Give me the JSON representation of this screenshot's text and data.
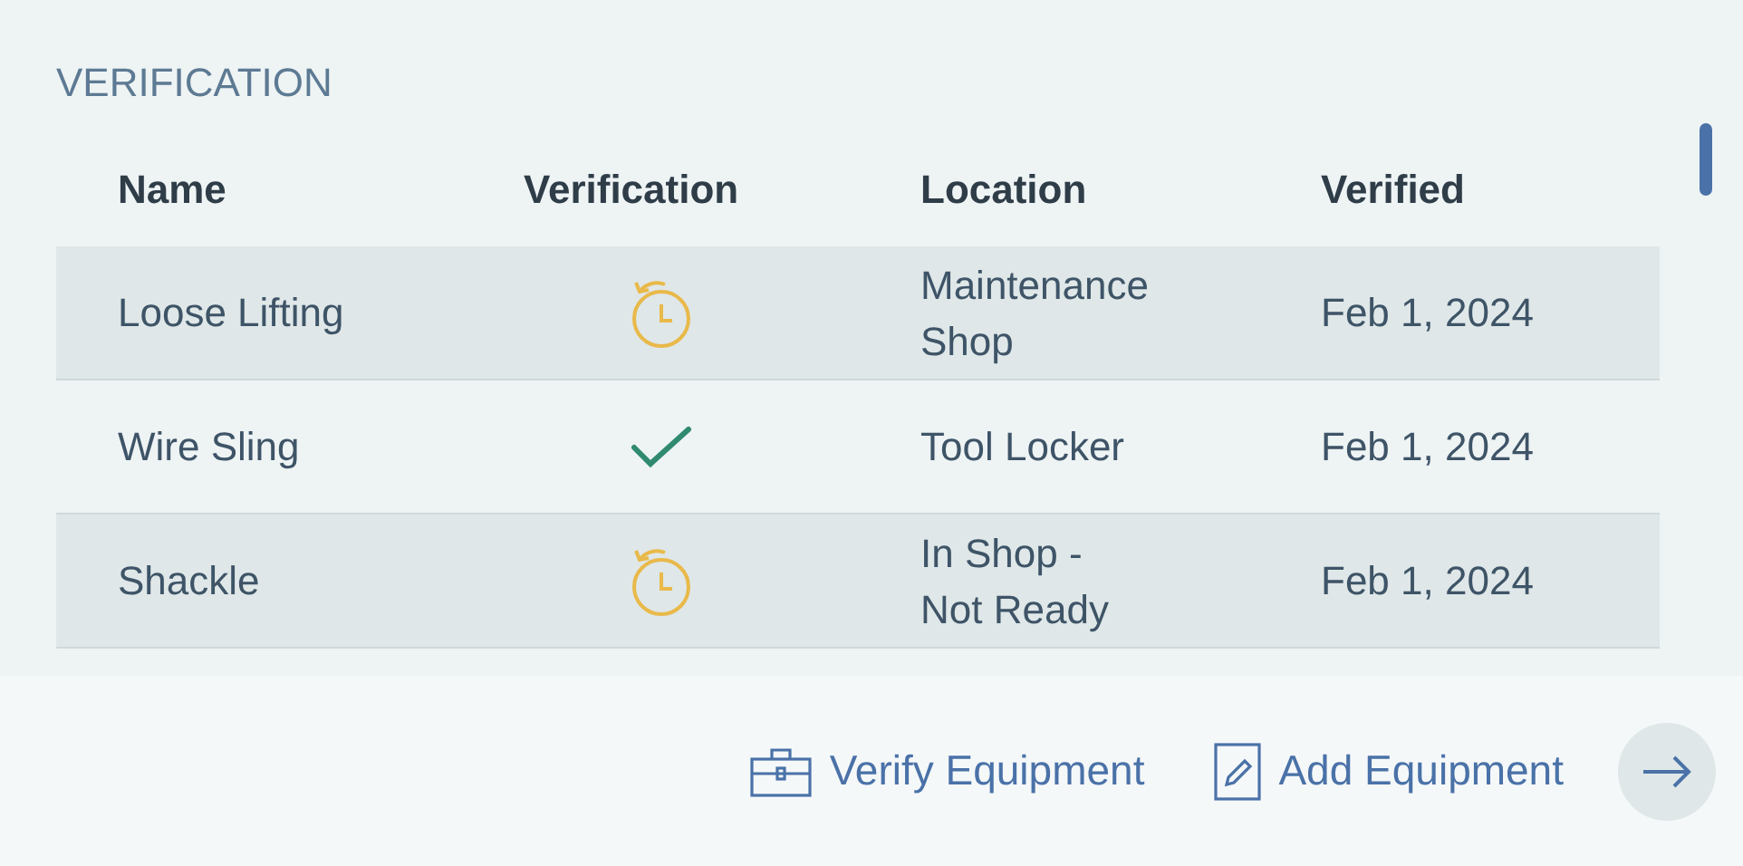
{
  "section_title": "VERIFICATION",
  "table": {
    "columns": [
      "Name",
      "Verification",
      "Location",
      "Verified"
    ],
    "rows": [
      {
        "name": "Loose Lifting",
        "kind": "pending",
        "location": "Maintenance Shop",
        "verified": "Feb 1, 2024"
      },
      {
        "name": "Wire Sling",
        "kind": "verified",
        "location": "Tool Locker",
        "verified": "Feb 1, 2024"
      },
      {
        "name": "Shackle",
        "kind": "pending",
        "location": "In Shop - Not Ready",
        "verified": "Feb 1, 2024"
      }
    ]
  },
  "actions": [
    {
      "kind": "verify",
      "label": "Verify Equipment"
    },
    {
      "kind": "add",
      "label": "Add Equipment"
    }
  ]
}
